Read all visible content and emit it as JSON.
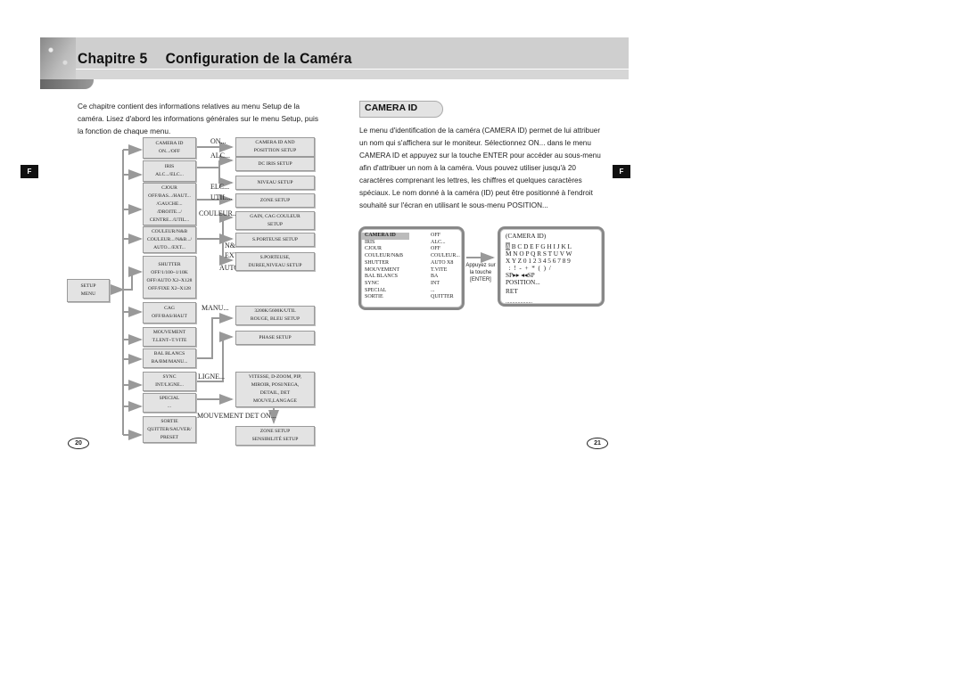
{
  "header": {
    "chapter": "Chapitre 5",
    "title": "Configuration de la Caméra"
  },
  "side_tab_label": "F",
  "left_page": {
    "intro": "Ce chapitre contient des informations relatives au menu Setup de la caméra. Lisez d'abord les informations générales sur le menu Setup, puis la fonction de chaque menu.",
    "page_number": "20",
    "diagram": {
      "root": {
        "line1": "SETUP",
        "line2": "MENU"
      },
      "menu_items": [
        {
          "lines": [
            "CAMERA ID",
            "ON.../OFF"
          ]
        },
        {
          "lines": [
            "IRIS",
            "ALC.../ELC..."
          ]
        },
        {
          "lines": [
            "CJOUR",
            "OFF/BAS.../HAUT...",
            "/GAUCHE...",
            "/DROITE.../",
            "CENTRE.../UTIL..."
          ]
        },
        {
          "lines": [
            "COULEUR/N&B",
            "COULEUR.../N&B.../",
            "AUTO.../EXT..."
          ]
        },
        {
          "lines": [
            "SHUTTER",
            "OFF/1/100~1/10K",
            "OFF/AUTO X2~X128",
            "OFF/FIXE X2~X128"
          ]
        },
        {
          "lines": [
            "CAG",
            "OFF/BAS/HAUT"
          ]
        },
        {
          "lines": [
            "MOUVEMENT",
            "T.LENT~T.VITE"
          ]
        },
        {
          "lines": [
            "BAL BLANCS",
            "BA/BM/MANU..."
          ]
        },
        {
          "lines": [
            "SYNC",
            "INT/LIGNE..."
          ]
        },
        {
          "lines": [
            "SPECIAL",
            "..."
          ]
        },
        {
          "lines": [
            "SORTIE",
            "QUITTER/SAUVER/",
            "PRESET"
          ]
        }
      ],
      "option_labels": {
        "on": "ON...",
        "alc": "ALC...",
        "elc": "ELC...",
        "util": "UTIL...",
        "couleur": "COULEUR...",
        "nb": "N&B...",
        "ext": "EXT...",
        "auto": "AUTO...",
        "manu": "MANU...",
        "ligne": "LIGNE...",
        "mouvement_det": "MOUVEMENT DET ON..."
      },
      "submenus": [
        {
          "lines": [
            "CAMERA ID AND",
            "POSITTION SETUP"
          ]
        },
        {
          "lines": [
            "DC IRIS SETUP"
          ]
        },
        {
          "lines": [
            "NIVEAU SETUP"
          ]
        },
        {
          "lines": [
            "ZONE SETUP"
          ]
        },
        {
          "lines": [
            "GAIN, CAG COULEUR",
            "SETUP"
          ]
        },
        {
          "lines": [
            "S.PORTEUSE SETUP"
          ]
        },
        {
          "lines": [
            "S.PORTEUSE,",
            "DUREE,NIVEAU SETUP"
          ]
        },
        {
          "lines": [
            "3200K/5600K/UTIL",
            "ROUGE, BLEU SETUP"
          ]
        },
        {
          "lines": [
            "PHASE SETUP"
          ]
        },
        {
          "lines": [
            "VITESSE, D-ZOOM, PIP,",
            "MIROIR, POSI/NEGA,",
            "DETAIL, DET",
            "MOUVE,LANGAGE"
          ]
        },
        {
          "lines": [
            "ZONE SETUP",
            "SENSIBILITÉ SETUP"
          ]
        }
      ]
    }
  },
  "right_page": {
    "section_title": "CAMERA ID",
    "body": "Le menu d'identification de la caméra (CAMERA ID) permet de lui attribuer un nom qui s'affichera sur le moniteur. Sélectionnez ON... dans le menu CAMERA ID et appuyez sur la touche ENTER pour accéder au sous-menu afin d'attribuer un nom à la caméra. Vous pouvez utiliser jusqu'à 20 caractères comprenant les lettres, les chiffres et quelques caractères spéciaux. Le nom donné à la caméra (ID) peut être positionné à l'endroit souhaité sur l'écran en utilisant le sous-menu POSITION...",
    "page_number": "21",
    "setup_screen": {
      "rows": [
        {
          "key": "CAMERA ID",
          "value": "OFF",
          "selected": true
        },
        {
          "key": "IRIS",
          "value": "ALC..."
        },
        {
          "key": "CJOUR",
          "value": "OFF"
        },
        {
          "key": "COULEUR/N&B",
          "value": "COULEUR..."
        },
        {
          "key": "SHUTTER",
          "value": "AUTO X8"
        },
        {
          "key": "MOUVEMENT",
          "value": "T.VITE"
        },
        {
          "key": "BAL BLANCS",
          "value": "BA"
        },
        {
          "key": "SYNC",
          "value": "INT"
        },
        {
          "key": "SPECIAL",
          "value": "..."
        },
        {
          "key": "SORTIE",
          "value": "QUITTER"
        }
      ]
    },
    "press_label": {
      "line1": "Appuyez sur",
      "line2": "la touche",
      "line3": "[ENTER]"
    },
    "camera_id_screen": {
      "title": "(CAMERA ID)",
      "selected_char": "A",
      "row1_rest": " B C D E F G H I J K L",
      "row2": "M N O P Q R S T U V W",
      "row3": "X Y Z 0 1 2 3 4 5 6 7 8 9",
      "row4": "  :  !  -  +  *  (  )  /",
      "sp_row": "SP▸▸ ◂◂SP",
      "position": "POSITION...",
      "ret": "RET",
      "name_field": "...................."
    }
  }
}
